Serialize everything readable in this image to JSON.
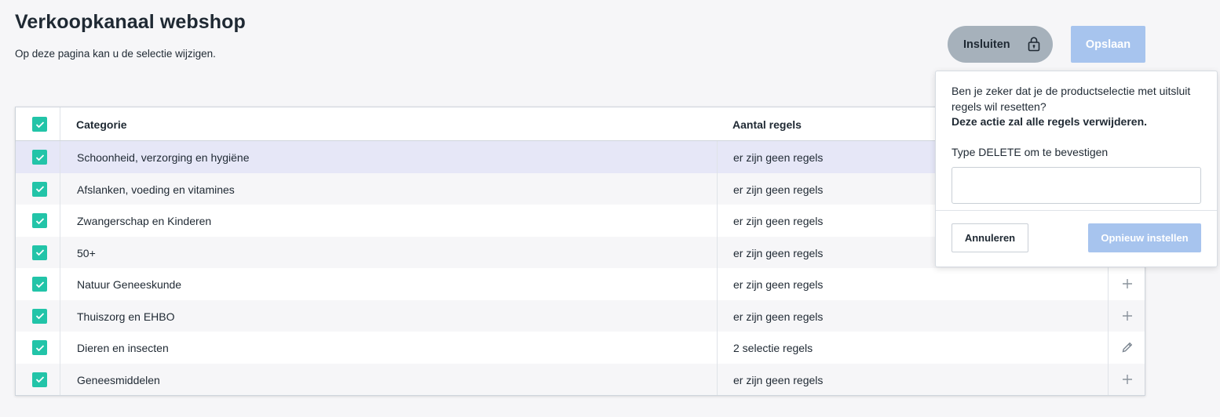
{
  "header": {
    "title": "Verkoopkanaal webshop",
    "subtitle": "Op deze pagina kan u de selectie wijzigen."
  },
  "actions": {
    "insluiten_label": "Insluiten",
    "insluiten_icon": "lock-icon",
    "opslaan_label": "Opslaan"
  },
  "table": {
    "columns": [
      "Categorie",
      "Aantal regels"
    ],
    "rows": [
      {
        "checked": true,
        "category": "Schoonheid, verzorging en hygiëne",
        "rules": "er zijn geen regels",
        "action_icon": "plus-icon"
      },
      {
        "checked": true,
        "category": "Afslanken, voeding en vitamines",
        "rules": "er zijn geen regels",
        "action_icon": "plus-icon"
      },
      {
        "checked": true,
        "category": "Zwangerschap en Kinderen",
        "rules": "er zijn geen regels",
        "action_icon": "plus-icon"
      },
      {
        "checked": true,
        "category": "50+",
        "rules": "er zijn geen regels",
        "action_icon": "plus-icon"
      },
      {
        "checked": true,
        "category": "Natuur Geneeskunde",
        "rules": "er zijn geen regels",
        "action_icon": "plus-icon"
      },
      {
        "checked": true,
        "category": "Thuiszorg en EHBO",
        "rules": "er zijn geen regels",
        "action_icon": "plus-icon"
      },
      {
        "checked": true,
        "category": "Dieren en insecten",
        "rules": "2 selectie regels",
        "action_icon": "pencil-icon"
      },
      {
        "checked": true,
        "category": "Geneesmiddelen",
        "rules": "er zijn geen regels",
        "action_icon": "plus-icon"
      }
    ]
  },
  "popover": {
    "message": "Ben je zeker dat je de productselectie met uitsluit regels wil resetten?",
    "warning": "Deze actie zal alle regels verwijderen.",
    "confirm_label": "Type DELETE om te bevestigen",
    "input_value": "",
    "cancel_label": "Annuleren",
    "reset_label": "Opnieuw instellen"
  },
  "colors": {
    "accent_check": "#22c4a8",
    "primary_disabled": "#a7c4ee",
    "insluiten_bg": "#a6b1bb",
    "row_selected": "#e6e7f7"
  }
}
